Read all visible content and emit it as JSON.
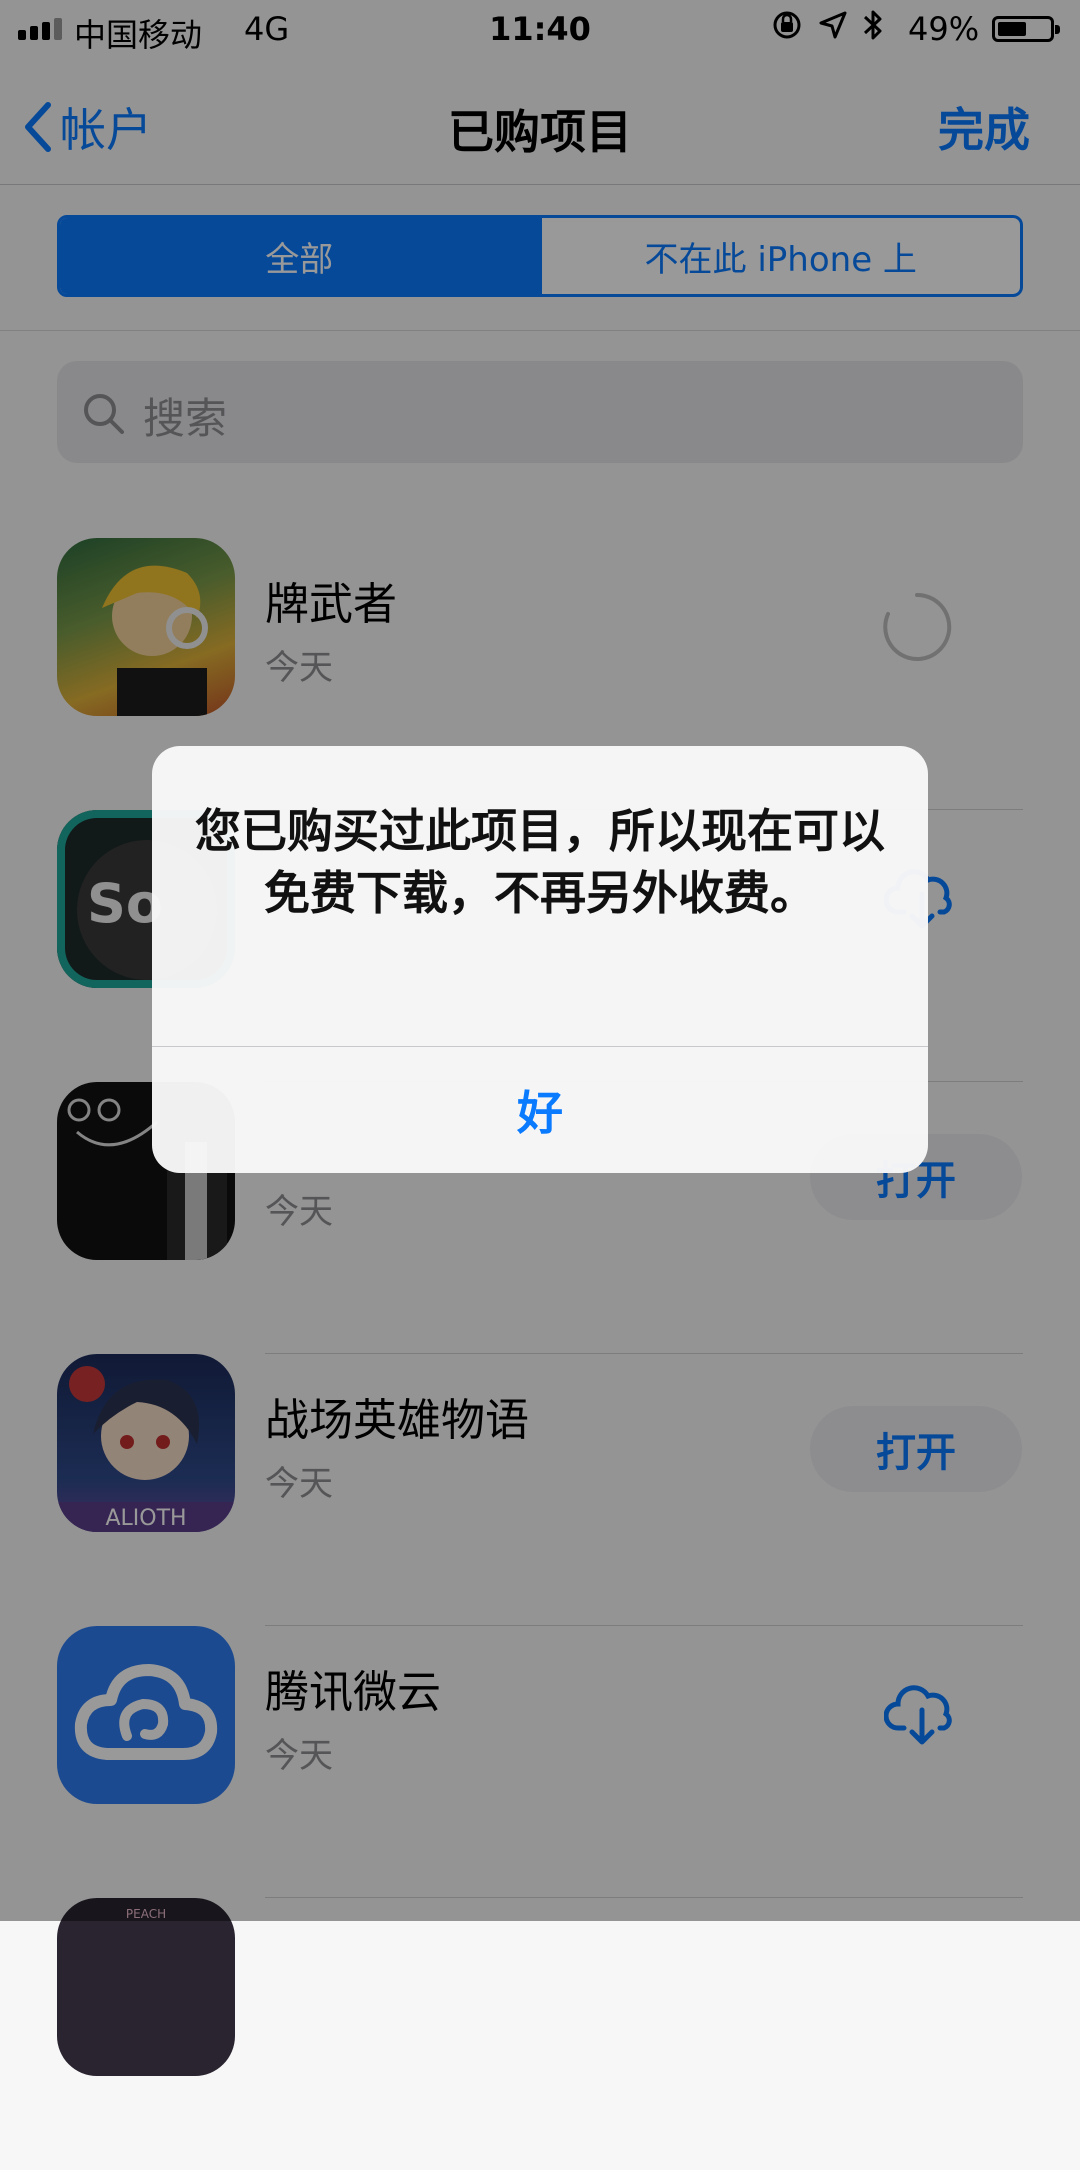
{
  "status_bar": {
    "carrier": "中国移动",
    "network": "4G",
    "time": "11:40",
    "battery_percent": "49%",
    "battery_level": 0.49,
    "icons": [
      "orientation-lock-icon",
      "location-icon",
      "bluetooth-icon"
    ]
  },
  "nav": {
    "back_label": "帐户",
    "title": "已购项目",
    "done_label": "完成"
  },
  "segments": {
    "selected": "全部",
    "other": "不在此 iPhone 上"
  },
  "search": {
    "placeholder": "搜索"
  },
  "apps": [
    {
      "name": "牌武者",
      "date": "今天",
      "action": "loading"
    },
    {
      "name": "",
      "date": "",
      "action": "download"
    },
    {
      "name": "",
      "date": "今天",
      "action": "open",
      "action_label": "打开"
    },
    {
      "name": "战场英雄物语",
      "date": "今天",
      "action": "open",
      "action_label": "打开",
      "icon_text": "ALIOTH"
    },
    {
      "name": "腾讯微云",
      "date": "今天",
      "action": "download"
    },
    {
      "name": "",
      "date": "",
      "action": "",
      "icon_text": "PEACH"
    }
  ],
  "alert": {
    "message": "您已购买过此项目，所以现在可以免费下载，不再另外收费。",
    "ok_label": "好"
  },
  "colors": {
    "accent": "#0a7aff",
    "background": "#f7f7f7"
  }
}
